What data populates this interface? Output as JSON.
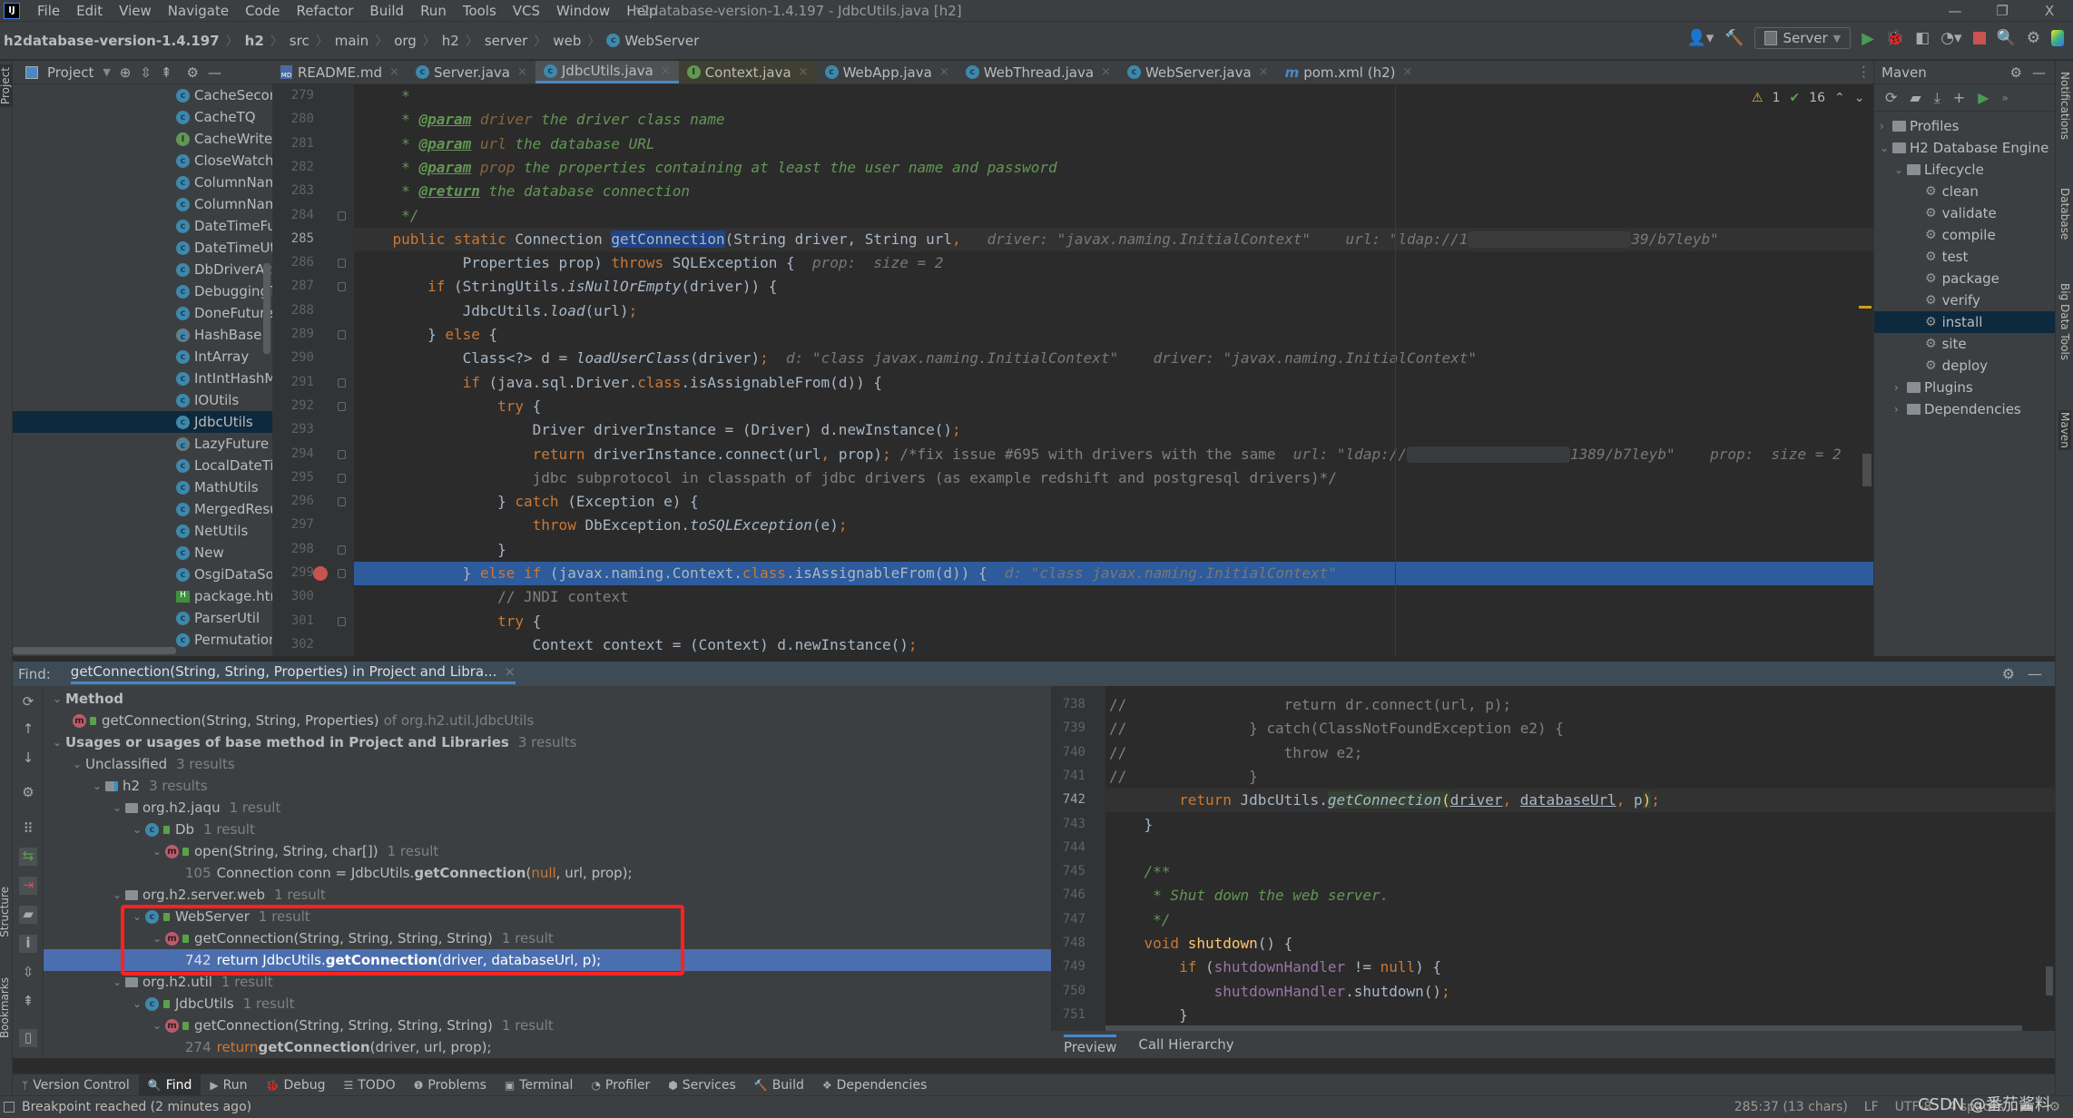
{
  "titlebar": {
    "menus": [
      "File",
      "Edit",
      "View",
      "Navigate",
      "Code",
      "Refactor",
      "Build",
      "Run",
      "Tools",
      "VCS",
      "Window",
      "Help"
    ],
    "window_title": "h2database-version-1.4.197 - JdbcUtils.java [h2]",
    "window_buttons": [
      "—",
      "❐",
      "X"
    ]
  },
  "navbar": {
    "breadcrumbs": [
      "h2database-version-1.4.197",
      "h2",
      "src",
      "main",
      "org",
      "h2",
      "server",
      "web",
      "WebServer"
    ],
    "run_config": "Server"
  },
  "project_panel": {
    "title": "Project",
    "items": [
      "CacheSecon",
      "CacheTQ",
      "CacheWriter",
      "CloseWatch",
      "ColumnNam",
      "ColumnNam",
      "DateTimeFu",
      "DateTimeUti",
      "DbDriverAct",
      "DebuggingT",
      "DoneFuture",
      "HashBase",
      "IntArray",
      "IntIntHashM",
      "IOUtils",
      "JdbcUtils",
      "LazyFuture",
      "LocalDateTi",
      "MathUtils",
      "MergedResu",
      "NetUtils",
      "New",
      "OsgiDataSo",
      "package.htm",
      "ParserUtil",
      "Permutation"
    ],
    "item_kinds": [
      "class",
      "class",
      "interface",
      "class",
      "class",
      "class",
      "class",
      "class",
      "class",
      "class",
      "class",
      "abstract",
      "class",
      "class",
      "class",
      "class",
      "abstract",
      "class",
      "class",
      "class",
      "class",
      "class",
      "class",
      "html",
      "class",
      "class"
    ],
    "selected": "JdbcUtils"
  },
  "tabs": [
    {
      "label": "README.md",
      "icon": "markdown-icon"
    },
    {
      "label": "Server.java",
      "icon": "class-icon"
    },
    {
      "label": "JdbcUtils.java",
      "icon": "class-icon",
      "active": true
    },
    {
      "label": "Context.java",
      "icon": "interface-icon"
    },
    {
      "label": "WebApp.java",
      "icon": "class-icon"
    },
    {
      "label": "WebThread.java",
      "icon": "class-icon"
    },
    {
      "label": "WebServer.java",
      "icon": "class-icon"
    },
    {
      "label": "pom.xml (h2)",
      "icon": "maven-icon"
    }
  ],
  "editor": {
    "inspection": {
      "warnings": "1",
      "ok": "16"
    },
    "line_numbers": [
      "279",
      "280",
      "281",
      "282",
      "283",
      "284",
      "285",
      "286",
      "287",
      "288",
      "289",
      "290",
      "291",
      "292",
      "293",
      "294",
      "295",
      "296",
      "297",
      "298",
      "299",
      "300",
      "301",
      "302"
    ],
    "current_line": "285",
    "exec_line": "299",
    "hints": {
      "l285_driver": "driver: \"javax.naming.InitialContext\"",
      "l285_url_a": "url: \"ldap://1",
      "l285_url_b": "39/b7leyb\"",
      "l286_prop": "prop:  size = 2",
      "l290_d": "d: \"class javax.naming.InitialContext\"",
      "l290_driver": "driver: \"javax.naming.InitialContext\"",
      "l294_url_a": "url: \"ldap://",
      "l294_url_b": "1389/b7leyb\"",
      "l294_prop": "prop:  size = 2",
      "l299_d": "d: \"class javax.naming.InitialContext\""
    }
  },
  "maven": {
    "title": "Maven",
    "tree": [
      {
        "label": "Profiles",
        "level": 0,
        "expanded": false,
        "kind": "profiles"
      },
      {
        "label": "H2 Database Engine",
        "level": 0,
        "expanded": true,
        "kind": "project"
      },
      {
        "label": "Lifecycle",
        "level": 1,
        "expanded": true,
        "kind": "folder"
      },
      {
        "label": "clean",
        "level": 2,
        "kind": "goal"
      },
      {
        "label": "validate",
        "level": 2,
        "kind": "goal"
      },
      {
        "label": "compile",
        "level": 2,
        "kind": "goal"
      },
      {
        "label": "test",
        "level": 2,
        "kind": "goal"
      },
      {
        "label": "package",
        "level": 2,
        "kind": "goal"
      },
      {
        "label": "verify",
        "level": 2,
        "kind": "goal"
      },
      {
        "label": "install",
        "level": 2,
        "kind": "goal",
        "selected": true
      },
      {
        "label": "site",
        "level": 2,
        "kind": "goal"
      },
      {
        "label": "deploy",
        "level": 2,
        "kind": "goal"
      },
      {
        "label": "Plugins",
        "level": 1,
        "expanded": false,
        "kind": "folder"
      },
      {
        "label": "Dependencies",
        "level": 1,
        "expanded": false,
        "kind": "deps"
      }
    ]
  },
  "right_strip": [
    "Notifications",
    "Database",
    "Big Data Tools",
    "Maven"
  ],
  "left_strip": [
    "Project",
    "Structure",
    "Bookmarks"
  ],
  "find": {
    "label": "Find:",
    "tab": "getConnection(String, String, Properties) in Project and Libra...",
    "rows": [
      {
        "indent": 0,
        "text": "Method",
        "bold": true,
        "chev": true
      },
      {
        "indent": 1,
        "text": "getConnection(String, String, Properties)",
        "suffix": "of org.h2.util.JdbcUtils",
        "icon": "method"
      },
      {
        "indent": 0,
        "text": "Usages or usages of base method in Project and Libraries",
        "count": "3 results",
        "bold": true,
        "chev": true
      },
      {
        "indent": 1,
        "text": "Unclassified",
        "count": "3 results",
        "chev": true
      },
      {
        "indent": 2,
        "text": "h2",
        "count": "3 results",
        "chev": true,
        "icon": "module"
      },
      {
        "indent": 3,
        "text": "org.h2.jaqu",
        "count": "1 result",
        "chev": true,
        "icon": "package"
      },
      {
        "indent": 4,
        "text": "Db",
        "count": "1 result",
        "chev": true,
        "icon": "class"
      },
      {
        "indent": 5,
        "text": "open(String, String, char[])",
        "count": "1 result",
        "chev": true,
        "icon": "method"
      },
      {
        "indent": 6,
        "line": "105",
        "pre": "Connection conn = JdbcUtils.",
        "hl": "getConnection",
        "post_kw": "null",
        "post": ", url, prop);"
      },
      {
        "indent": 3,
        "text": "org.h2.server.web",
        "count": "1 result",
        "chev": true,
        "icon": "package"
      },
      {
        "indent": 4,
        "text": "WebServer",
        "count": "1 result",
        "chev": true,
        "icon": "class"
      },
      {
        "indent": 5,
        "text": "getConnection(String, String, String, String)",
        "count": "1 result",
        "chev": true,
        "icon": "method"
      },
      {
        "indent": 6,
        "line": "742",
        "pre": "return JdbcUtils.",
        "hl": "getConnection",
        "post": "(driver, databaseUrl, p);",
        "selected": true
      },
      {
        "indent": 3,
        "text": "org.h2.util",
        "count": "1 result",
        "chev": true,
        "icon": "package"
      },
      {
        "indent": 4,
        "text": "JdbcUtils",
        "count": "1 result",
        "chev": true,
        "icon": "class"
      },
      {
        "indent": 5,
        "text": "getConnection(String, String, String, String)",
        "count": "1 result",
        "chev": true,
        "icon": "method"
      },
      {
        "indent": 6,
        "line": "274",
        "pre_kw": "return ",
        "hl": "getConnection",
        "post": "(driver, url, prop);"
      }
    ]
  },
  "preview": {
    "line_numbers": [
      "738",
      "739",
      "740",
      "741",
      "742",
      "743",
      "744",
      "745",
      "746",
      "747",
      "748",
      "749",
      "750",
      "751"
    ],
    "current_line": "742",
    "tabs": [
      "Preview",
      "Call Hierarchy"
    ]
  },
  "bottom_tools": [
    {
      "label": "Version Control",
      "icon": "vcs-icon"
    },
    {
      "label": "Find",
      "icon": "search-icon",
      "active": true
    },
    {
      "label": "Run",
      "icon": "run-icon"
    },
    {
      "label": "Debug",
      "icon": "debug-icon"
    },
    {
      "label": "TODO",
      "icon": "todo-icon"
    },
    {
      "label": "Problems",
      "icon": "problems-icon"
    },
    {
      "label": "Terminal",
      "icon": "terminal-icon"
    },
    {
      "label": "Profiler",
      "icon": "profiler-icon"
    },
    {
      "label": "Services",
      "icon": "services-icon"
    },
    {
      "label": "Build",
      "icon": "build-icon"
    },
    {
      "label": "Dependencies",
      "icon": "dependencies-icon"
    }
  ],
  "status": {
    "message": "Breakpoint reached (2 minutes ago)",
    "position": "285:37 (13 chars)",
    "line_sep": "LF",
    "encoding": "UTF-8",
    "indent": "4 spaces"
  },
  "watermark": "CSDN @番茄酱料"
}
